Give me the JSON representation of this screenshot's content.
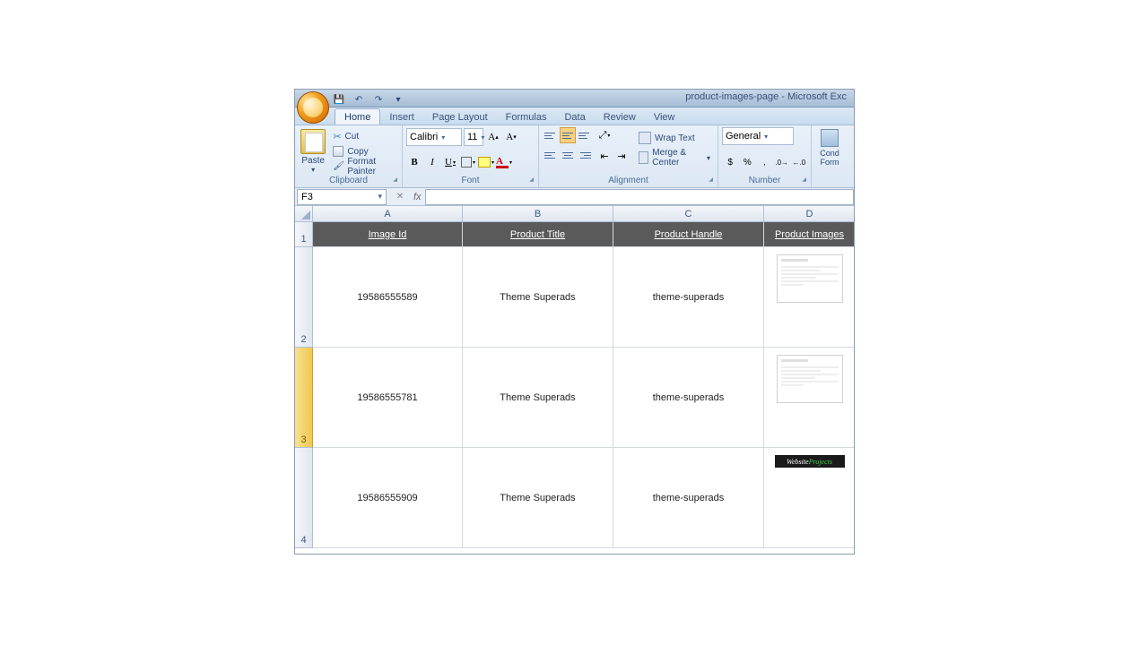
{
  "title": "product-images-page - Microsoft Exc",
  "tabs": [
    "Home",
    "Insert",
    "Page Layout",
    "Formulas",
    "Data",
    "Review",
    "View"
  ],
  "activeTab": "Home",
  "clipboard": {
    "label": "Clipboard",
    "paste": "Paste",
    "cut": "Cut",
    "copy": "Copy",
    "fp": "Format Painter"
  },
  "font": {
    "label": "Font",
    "name": "Calibri",
    "size": "11"
  },
  "alignment": {
    "label": "Alignment",
    "wrap": "Wrap Text",
    "merge": "Merge & Center"
  },
  "number": {
    "label": "Number",
    "format": "General"
  },
  "cond": {
    "l1": "Cond",
    "l2": "Form"
  },
  "namebox": "F3",
  "fx": "fx",
  "columns": [
    "A",
    "B",
    "C",
    "D"
  ],
  "headerRow": [
    "Image Id",
    "Product Title",
    "Product Handle",
    "Product Images"
  ],
  "rows": [
    {
      "n": "2",
      "a": "19586555589",
      "b": "Theme Superads",
      "c": "theme-superads",
      "img": "doc"
    },
    {
      "n": "3",
      "a": "19586555781",
      "b": "Theme Superads",
      "c": "theme-superads",
      "img": "doc",
      "sel": true
    },
    {
      "n": "4",
      "a": "19586555909",
      "b": "Theme Superads",
      "c": "theme-superads",
      "img": "badge"
    }
  ],
  "badge": {
    "w": "Website",
    "p": "Projects"
  }
}
